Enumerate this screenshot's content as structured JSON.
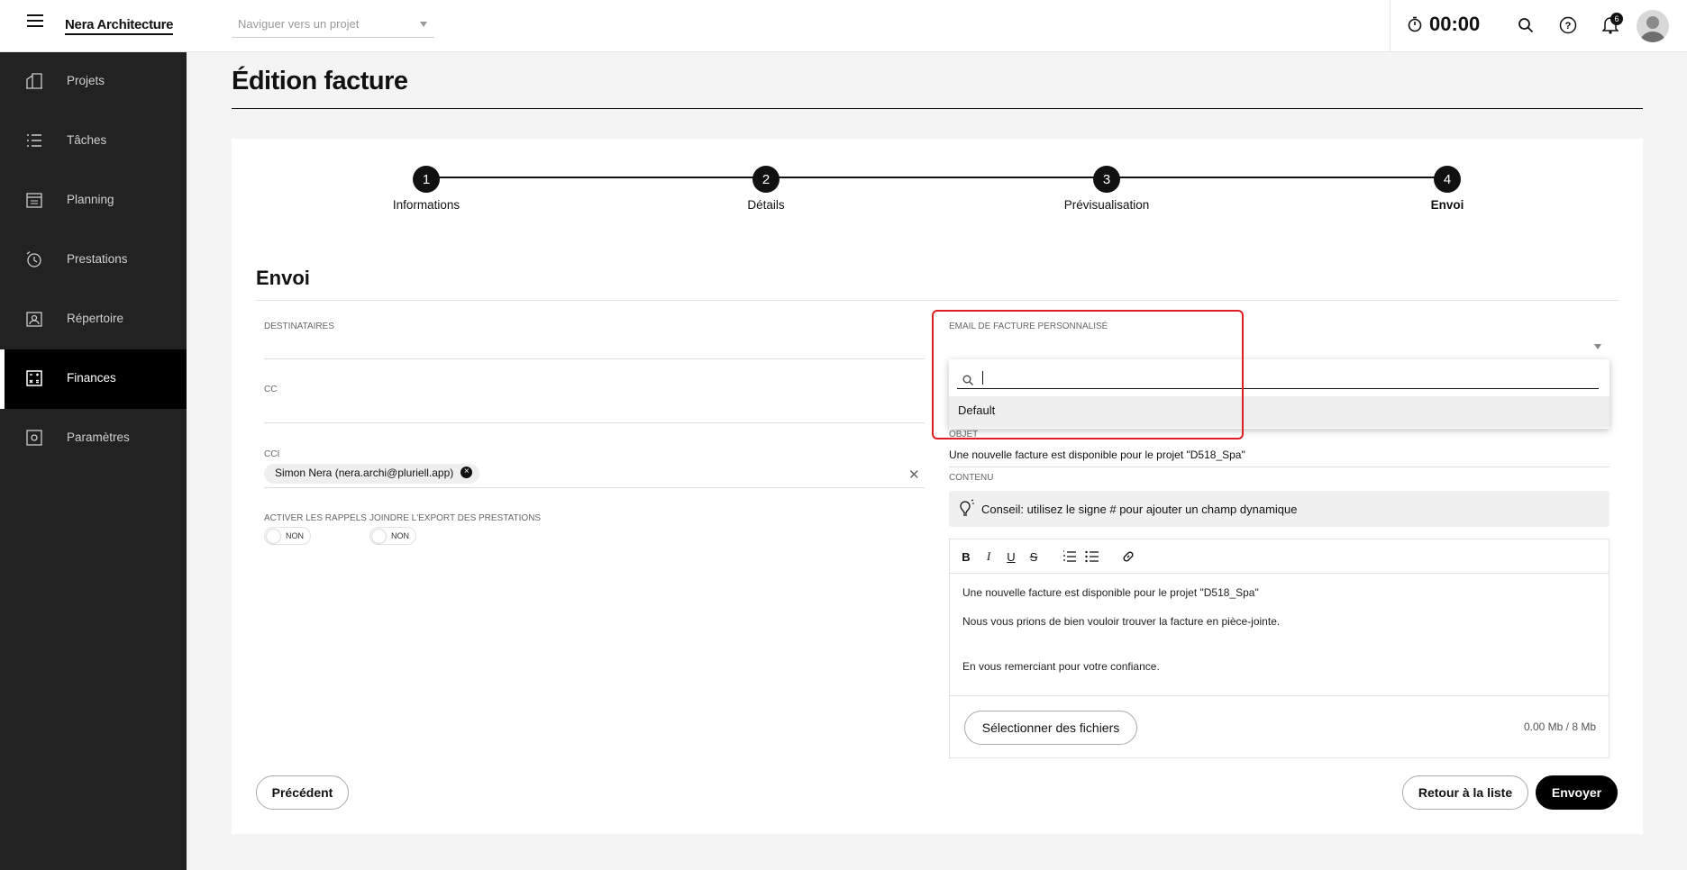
{
  "app": {
    "brand": "Nera Architecture",
    "project_nav_placeholder": "Naviguer vers un projet",
    "timer": "00:00",
    "notif_count": "6"
  },
  "sidebar": {
    "items": [
      {
        "label": "Projets"
      },
      {
        "label": "Tâches"
      },
      {
        "label": "Planning"
      },
      {
        "label": "Prestations"
      },
      {
        "label": "Répertoire"
      },
      {
        "label": "Finances",
        "active": true
      },
      {
        "label": "Paramètres"
      }
    ]
  },
  "page": {
    "title": "Édition facture"
  },
  "steps": [
    {
      "num": "1",
      "label": "Informations"
    },
    {
      "num": "2",
      "label": "Détails"
    },
    {
      "num": "3",
      "label": "Prévisualisation"
    },
    {
      "num": "4",
      "label": "Envoi",
      "active": true
    }
  ],
  "section": {
    "title": "Envoi"
  },
  "form": {
    "dest_label": "Destinataires",
    "cc_label": "CC",
    "cci_label": "CCI",
    "cci_chip": "Simon Nera (nera.archi@pluriell.app)",
    "reminders_label": "Activer les rappels",
    "reminders_value": "NON",
    "export_label": "Joindre l'export des prestations",
    "export_value": "NON",
    "email_template_label": "Email de facture personnalisé",
    "dropdown_option": "Default",
    "subject_label": "Objet",
    "subject_value": "Une nouvelle facture est disponible pour le projet \"D518_Spa\"",
    "content_label": "Contenu",
    "tip": "Conseil: utilisez le signe # pour ajouter un champ dynamique",
    "body": [
      "Une nouvelle facture est disponible pour le projet \"D518_Spa\"",
      "Nous vous prions de bien vouloir trouver la facture en pièce-jointe.",
      "En vous remerciant pour votre confiance."
    ],
    "attach_button": "Sélectionner des fichiers",
    "attach_size": "0.00 Mb / 8 Mb"
  },
  "actions": {
    "previous": "Précédent",
    "back_to_list": "Retour à la liste",
    "send": "Envoyer"
  },
  "colors": {
    "sidebar_bg": "#222222",
    "active_bg": "#000000",
    "highlight": "#e02020"
  }
}
